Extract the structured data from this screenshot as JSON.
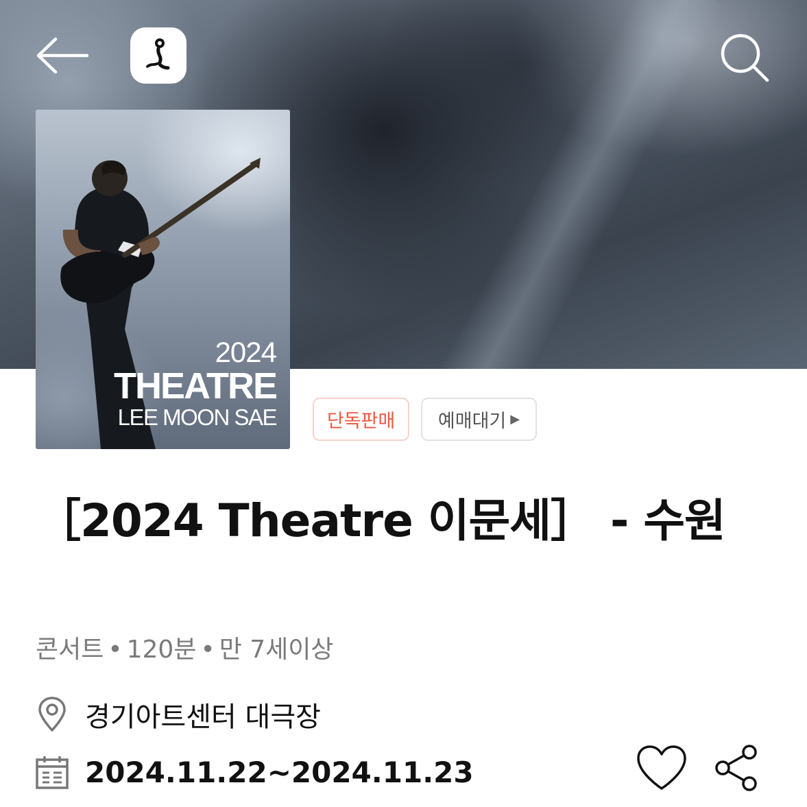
{
  "header": {
    "back_icon": "arrow-left-icon",
    "logo_icon": "app-logo-icon",
    "search_icon": "search-icon"
  },
  "poster": {
    "year": "2024",
    "title": "THEATRE",
    "artist": "LEE MOON SAE"
  },
  "badges": {
    "exclusive": "단독판매",
    "waiting": "예매대기",
    "waiting_arrow": "▶",
    "exclusive_color": "#f0563f"
  },
  "event": {
    "title": "［2024 Theatre 이문세］  - 수원",
    "genre": "콘서트",
    "duration": "120분",
    "age": "만 7세이상",
    "separator": "•",
    "venue": "경기아트센터 대극장",
    "dates": "2024.11.22~2024.11.23"
  },
  "icons": {
    "venue": "location-pin-icon",
    "date": "calendar-icon",
    "like": "heart-icon",
    "share": "share-icon"
  }
}
